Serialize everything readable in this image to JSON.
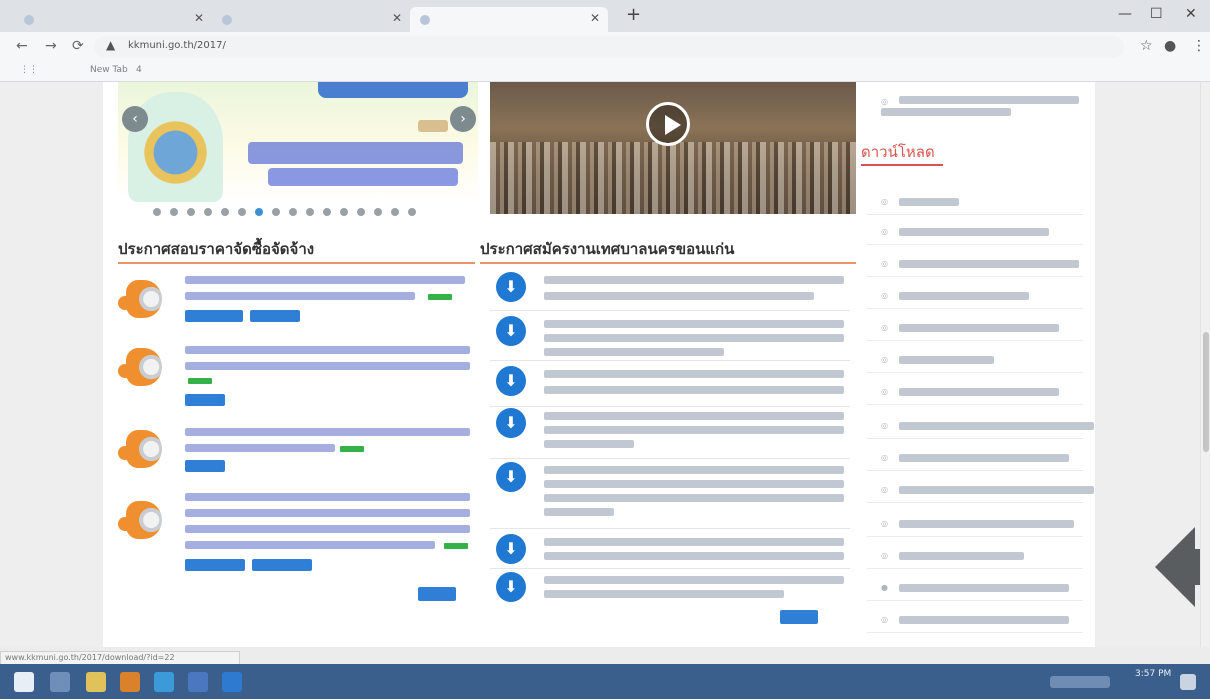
{
  "browser": {
    "tabs": [
      {
        "label": "",
        "active": false
      },
      {
        "label": "",
        "active": false
      },
      {
        "label": "",
        "active": true
      }
    ],
    "new_tab_icon": "plus-icon",
    "url": "kkmuni.go.th/2017/",
    "bookmarks": [
      {
        "label": ""
      },
      {
        "label": "New Tab"
      },
      {
        "label": "4"
      }
    ]
  },
  "page": {
    "left_section_title": "ประกาศสอบราคาจัดซื้อจัดจ้าง",
    "middle_section_title": "ประกาศสมัครงานเทศบาลนครขอนแก่น",
    "sidebar_title": "ดาวน์โหลด",
    "procurement_items": [
      {
        "badges": 2
      },
      {
        "badges": 1
      },
      {
        "badges": 1
      },
      {
        "badges": 2
      }
    ],
    "job_items_count": 8,
    "sidebar_items_count": 13
  },
  "statusbar": {
    "text": "www.kkmuni.go.th/2017/download/?id=22"
  },
  "taskbar": {
    "time": "3:57 PM"
  },
  "colors": {
    "accent_orange": "#e8956a",
    "sidebar_red": "#d9534f",
    "link_blue": "#2f7fd6",
    "taskbar": "#3b5f8d"
  }
}
